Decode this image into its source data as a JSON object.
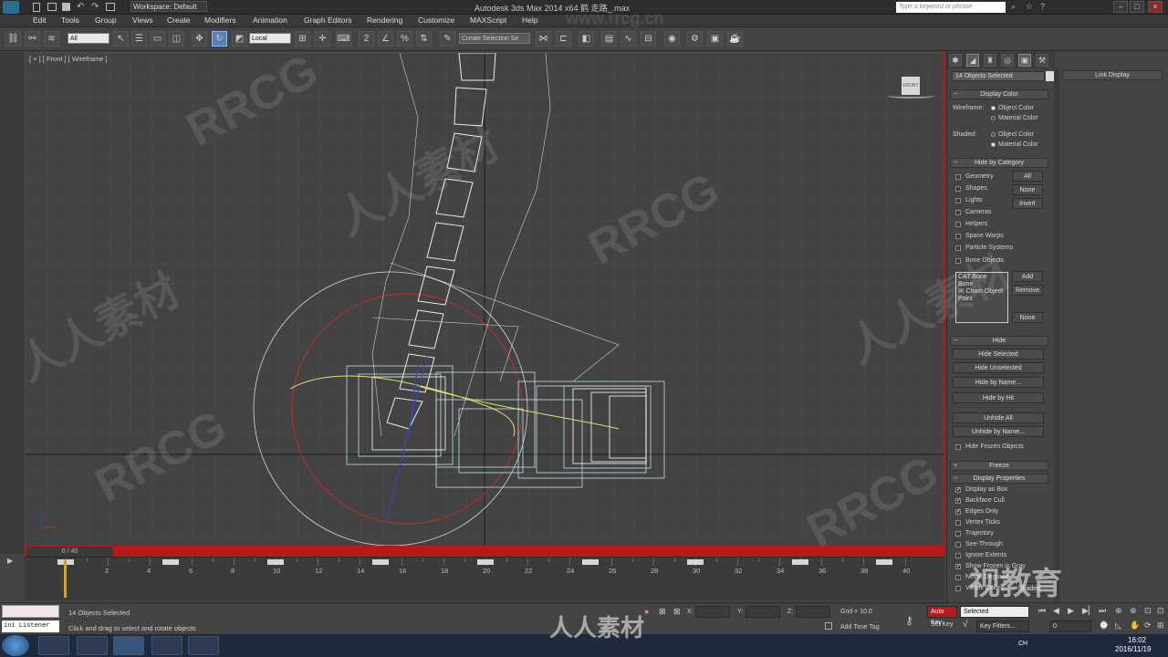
{
  "titlebar": {
    "app_title": "Autodesk 3ds Max  2014 x64    鹤 走路_.max",
    "workspace": "Workspace: Default",
    "search_placeholder": "Type a keyword or phrase"
  },
  "menu": [
    "Edit",
    "Tools",
    "Group",
    "Views",
    "Create",
    "Modifiers",
    "Animation",
    "Graph Editors",
    "Rendering",
    "Customize",
    "MAXScript",
    "Help"
  ],
  "toolbar": {
    "selection_filter": "All",
    "coord_system": "Local",
    "named_selection": "Create Selection Se"
  },
  "viewport": {
    "label": "[ + ] [ Front ] [ Wireframe ]",
    "viewcube_label": "FRONT"
  },
  "command_panel": {
    "selection_field": "14 Objects Selected",
    "display_color": {
      "header": "Display Color",
      "wireframe_label": "Wireframe:",
      "shaded_label": "Shaded:",
      "options": [
        "Object Color",
        "Material Color"
      ],
      "wireframe_selected": "Object Color",
      "shaded_selected": "Material Color"
    },
    "hide_by_category": {
      "header": "Hide by Category",
      "items": [
        "Geometry",
        "Shapes",
        "Lights",
        "Cameras",
        "Helpers",
        "Space Warps",
        "Particle Systems",
        "Bone Objects"
      ],
      "buttons": [
        "All",
        "None",
        "Invert"
      ],
      "list": [
        "CAT Bone",
        "Bone",
        "IK Chain Object",
        "Point"
      ],
      "list_buttons": [
        "Add",
        "Remove",
        "None"
      ]
    },
    "hide": {
      "header": "Hide",
      "buttons": [
        "Hide Selected",
        "Hide Unselected",
        "Hide by Name...",
        "Hide by Hit",
        "Unhide All",
        "Unhide by Name..."
      ],
      "checkbox": "Hide Frozen Objects"
    },
    "freeze": {
      "header": "Freeze"
    },
    "display_properties": {
      "header": "Display Properties",
      "items": [
        {
          "label": "Display as Box",
          "checked": true
        },
        {
          "label": "Backface Cull",
          "checked": true
        },
        {
          "label": "Edges Only",
          "checked": true
        },
        {
          "label": "Vertex Ticks",
          "checked": false
        },
        {
          "label": "Trajectory",
          "checked": false
        },
        {
          "label": "See-Through",
          "checked": false
        },
        {
          "label": "Ignore Extents",
          "checked": false
        },
        {
          "label": "Show Frozen in Gray",
          "checked": true
        },
        {
          "label": "Never Degrade",
          "checked": false
        },
        {
          "label": "Vertex Colors",
          "checked": false
        }
      ],
      "shaded_button": "Shaded"
    }
  },
  "right_panel": {
    "header": "Link Display"
  },
  "timeline": {
    "current": "0 / 40",
    "ticks": [
      "2",
      "4",
      "6",
      "8",
      "10",
      "12",
      "14",
      "16",
      "18",
      "20",
      "22",
      "24",
      "26",
      "28",
      "30",
      "32",
      "34",
      "36",
      "38",
      "40"
    ]
  },
  "status": {
    "selected": "14 Objects Selected",
    "prompt": "Click and drag to select and rotate objects",
    "listener": "ini Listener",
    "grid": "Grid = 10.0",
    "add_time_tag": "Add Time Tag",
    "x_label": "X:",
    "y_label": "Y:",
    "z_label": "Z:",
    "auto_key": "Auto Key",
    "set_key": "Set Key",
    "key_mode": "Selected",
    "key_filters": "Key Filters...",
    "frame": "0"
  },
  "taskbar": {
    "lang": "CH",
    "time": "16:02",
    "date": "2016/11/19"
  },
  "watermark": {
    "main": "RRCG",
    "cn": "人人素材",
    "url": "www.rrcg.cn",
    "brand": "视教育",
    "logo": "人人素材"
  },
  "colors": {
    "accent_red": "#b61a1a",
    "viewport_bg": "#434343",
    "selection_blue": "#5a7fb0"
  }
}
